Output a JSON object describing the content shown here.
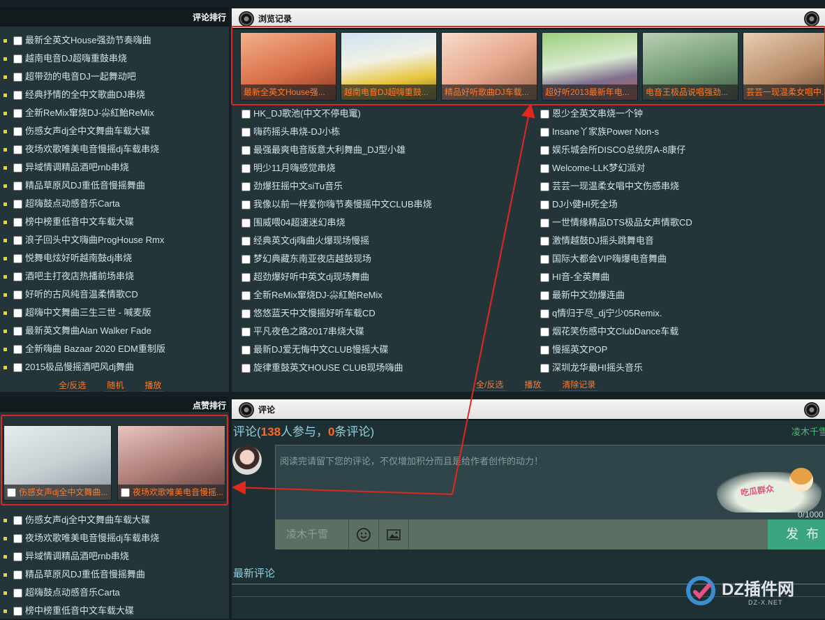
{
  "comment_rank": {
    "title": "评论排行",
    "songs": [
      "最新全英文House强劲节奏嗨曲",
      "越南电音DJ超嗨重鼓串烧",
      "超带劲的电音DJ一起舞动吧",
      "经典抒情的全中文歌曲DJ串烧",
      "全新ReMix窜烧DJ-尛紅鮐ReMix",
      "伤感女声dj全中文舞曲车载大碟",
      "夜场欢歌唯美电音慢摇dj车载串烧",
      "异域情调精品酒吧rnb串烧",
      "精品草原风DJ重低音慢摇舞曲",
      "超嗨鼓点动感音乐Carta",
      "榜中榜重低音中文车载大碟",
      "浪子回头中文嗨曲ProgHouse Rmx",
      "悦舞电炫好听越南鼓dj串烧",
      "酒吧主打夜店热播前场串烧",
      "好听的古风纯音温柔情歌CD",
      "超嗨中文舞曲三生三世 - 喊麦版",
      "最新英文舞曲Alan Walker Fade",
      "全新嗨曲 Bazaar 2020 EDM重制版",
      "2015极品慢摇酒吧风dj舞曲"
    ],
    "actions": [
      "全/反选",
      "随机",
      "播放"
    ]
  },
  "history": {
    "title": "浏览记录",
    "thumbs": [
      "最新全英文House强...",
      "越南电音DJ超嗨重鼓...",
      "精品好听歌曲DJ车载...",
      "超好听2013最新年电...",
      "电音王极品说唱强劲...",
      "芸芸一现温柔女唱中..."
    ],
    "col1": [
      "HK_DJ歌池(中文不停电竃)",
      "嗨药摇头串烧-DJ小栋",
      "最强最爽电音版意大利舞曲_DJ型小雄",
      "明少11月嗨感觉串烧",
      "劲爆狂摇中文siTu音乐",
      "我像以前一样爱你嗨节奏慢摇中文CLUB串烧",
      "围威喂04超速迷幻串烧",
      "经典英文dj嗨曲火爆现场慢摇",
      "梦幻典藏东南亚夜店越鼓现场",
      "超劲爆好听中英文dj现场舞曲",
      "全新ReMix窜烧DJ-尛紅鮐ReMix",
      "悠悠蓝天中文慢摇好听车载CD",
      "平凡夜色之路2017串烧大碟",
      "最新DJ爱无悔中文CLUB慢摇大碟",
      "旋律重鼓英文HOUSE CLUB现场嗨曲"
    ],
    "col2": [
      "恩少全英文串烧一个钟",
      "Insane丫家族Power Non-s",
      "娱乐城会所DISCO总统房A-8康仔",
      "Welcome-LLK梦幻派对",
      "芸芸一现温柔女唱中文伤感串烧",
      "DJ小健HI死全场",
      "一世情缘精品DTS极品女声情歌CD",
      "激情越鼓DJ摇头跳舞电音",
      "国际大都会VIP嗨爆电音舞曲",
      "HI音-全英舞曲",
      "最新中文劲爆连曲",
      "q情归于尽_dj宁少05Remix.",
      "烟花笑伤感中文ClubDance车载",
      "慢摇英文POP",
      "深圳龙华最HI摇头音乐"
    ],
    "actions": [
      "全/反选",
      "播放",
      "清除记录"
    ]
  },
  "like_rank": {
    "title": "点赞排行",
    "thumbs": [
      "伤感女声dj全中文舞曲...",
      "夜场欢歌唯美电音慢摇..."
    ],
    "songs": [
      "伤感女声dj全中文舞曲车载大碟",
      "夜场欢歌唯美电音慢摇dj车载串烧",
      "异域情调精品酒吧rnb串烧",
      "精品草原风DJ重低音慢摇舞曲",
      "超嗨鼓点动感音乐Carta",
      "榜中榜重低音中文车载大碟"
    ]
  },
  "comments": {
    "title": "评论",
    "heading_prefix": "评论(",
    "participants": "138",
    "heading_mid": "人参与，",
    "count": "0",
    "heading_suffix": "条评论)",
    "user_name": "凌木千雪",
    "placeholder": "阅读完请留下您的评论，不仅增加积分而且是给作者创作的动力！",
    "counter": "0/1000",
    "nickname": "凌木千雪",
    "publish": "发 布",
    "latest": "最新评论",
    "sticker_text": "吃瓜群众"
  },
  "watermark": {
    "brand": "DZ插件网",
    "url": "DZ-X.NET"
  },
  "colors": {
    "accent": "#ff7a2e",
    "highlight_box": "#e0281f",
    "publish": "#3aa57e"
  }
}
